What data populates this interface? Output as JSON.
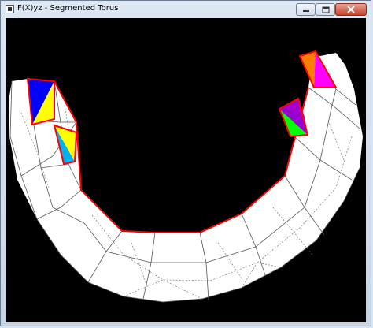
{
  "window": {
    "title": "F(X)yz - Segmented Torus"
  },
  "icons": {
    "app": "app-icon",
    "minimize": "minimize-icon",
    "maximize": "maximize-icon",
    "close": "close-icon"
  },
  "colors": {
    "background": "#000000",
    "mesh_fill": "#ffffff",
    "mesh_line": "#444444",
    "outline": "#ff0000",
    "facets": [
      "#0000ff",
      "#ffff00",
      "#00b0f0",
      "#ff8000",
      "#ff00ff",
      "#a000d0",
      "#00ff00"
    ]
  }
}
